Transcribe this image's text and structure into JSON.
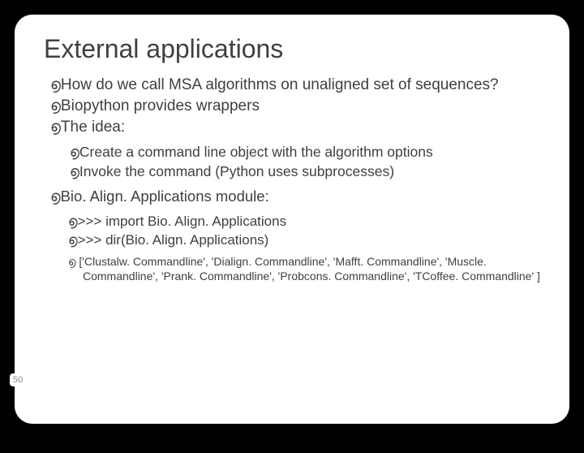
{
  "title": "External applications",
  "bullet": "൭",
  "items": {
    "a": "How do we call MSA algorithms on unaligned set of sequences?",
    "b": "Biopython provides wrappers",
    "c": "The idea:",
    "c1": "Create a command line object with the algorithm options",
    "c2": "Invoke the command (Python uses subprocesses)",
    "d": "Bio. Align. Applications module:",
    "d1": ">>> import Bio. Align. Applications",
    "d2": ">>> dir(Bio. Align. Applications)",
    "e": " ['Clustalw. Commandline', 'Dialign. Commandline', 'Mafft. Commandline', 'Muscle. Commandline', 'Prank. Commandline', 'Probcons. Commandline', 'TCoffee. Commandline' ]"
  },
  "page": "50"
}
